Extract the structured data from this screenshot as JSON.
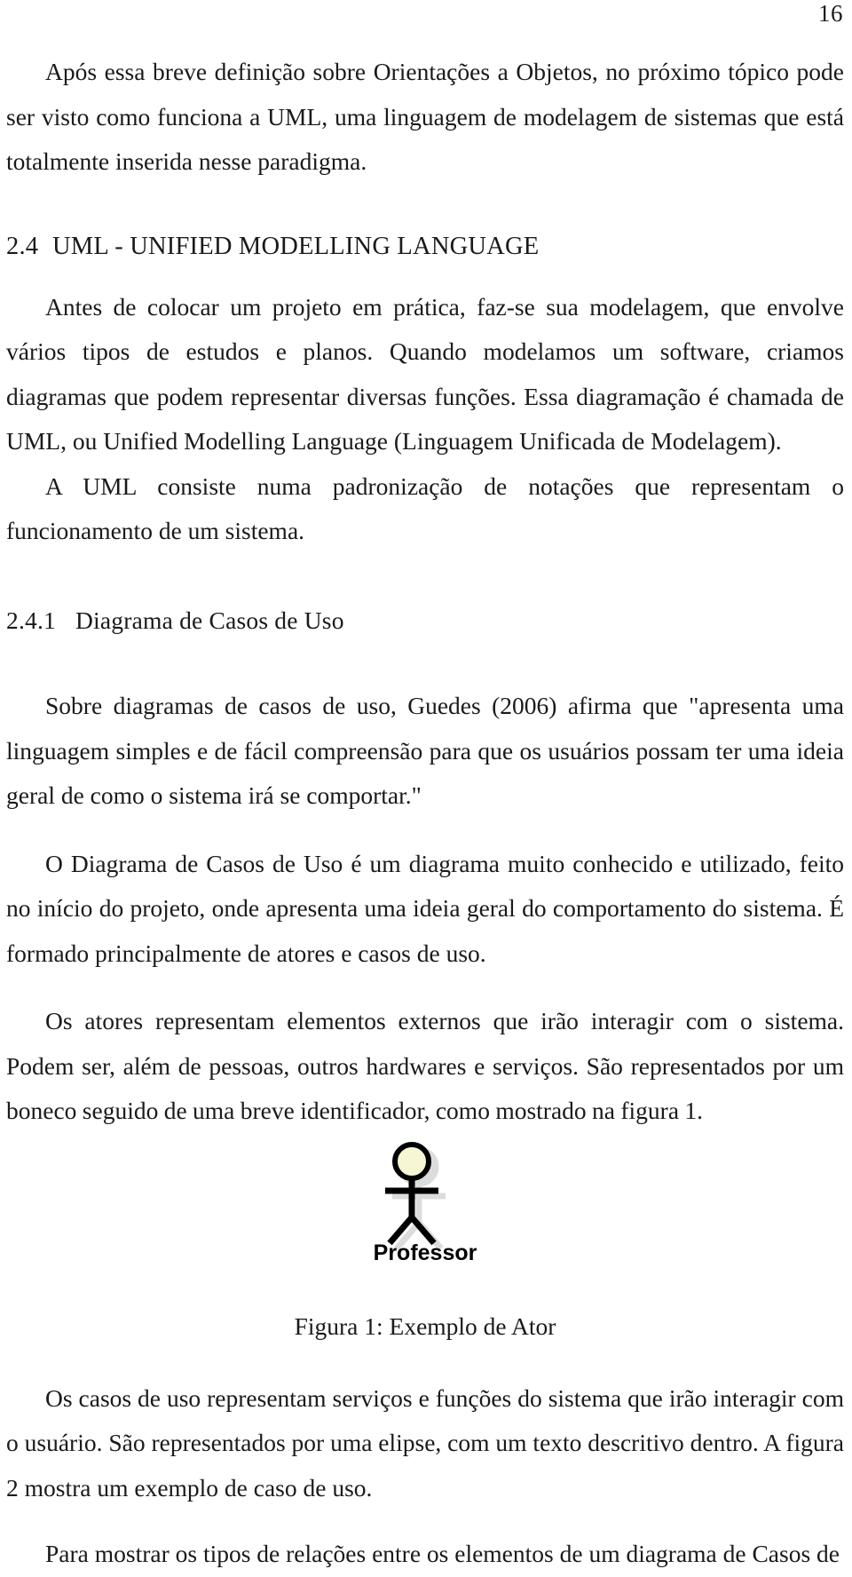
{
  "page": {
    "folio": "16",
    "language": "pt-BR"
  },
  "paragraphs": {
    "intro": "Após essa breve definição sobre Orientações a Objetos, no próximo tópico pode ser visto como funciona a UML, uma linguagem de modelagem de sistemas que está totalmente inserida nesse paradigma.",
    "uml_intro": "Antes de colocar um projeto em prática, faz-se sua modelagem, que envolve vários tipos de estudos e planos. Quando modelamos um software, criamos diagramas que podem representar diversas funções. Essa diagramação é chamada de UML, ou Unified Modelling Language (Linguagem Unificada de Modelagem).",
    "uml_def": "A UML consiste numa padronização de notações que representam o funcionamento de um sistema.",
    "guedes_quote": "Sobre diagramas de casos de uso, Guedes (2006) afirma que \"apresenta uma linguagem simples e de fácil compreensão para que os usuários possam ter uma ideia geral de como o sistema irá se comportar.\"",
    "use_case_diagram": "O Diagrama de Casos de Uso é um diagrama muito conhecido e utilizado, feito no início do projeto, onde apresenta uma ideia geral do comportamento do sistema. É formado principalmente de atores e casos de uso.",
    "actors": "Os atores representam elementos externos que irão interagir com o sistema. Podem ser, além de pessoas, outros hardwares e serviços. São representados por um boneco seguido de uma breve identificador, como mostrado na figura 1.",
    "use_cases": "Os casos de uso representam serviços e funções do sistema que irão interagir com o usuário. São representados por uma elipse, com um texto descritivo dentro. A figura 2 mostra um exemplo de caso de uso.",
    "relations_partial": "Para mostrar os tipos de relações entre os elementos de um diagrama de Casos de"
  },
  "section": {
    "number": "2.4",
    "title": "UML - UNIFIED MODELLING LANGUAGE"
  },
  "subsection": {
    "number": "2.4.1",
    "title": "Diagrama de Casos de Uso"
  },
  "figure": {
    "caption": "Figura 1: Exemplo de Ator",
    "actor_label": "Professor",
    "head_fill": "#f7f6d4",
    "stroke": "#000000",
    "shadow": "#d9d9d9"
  }
}
